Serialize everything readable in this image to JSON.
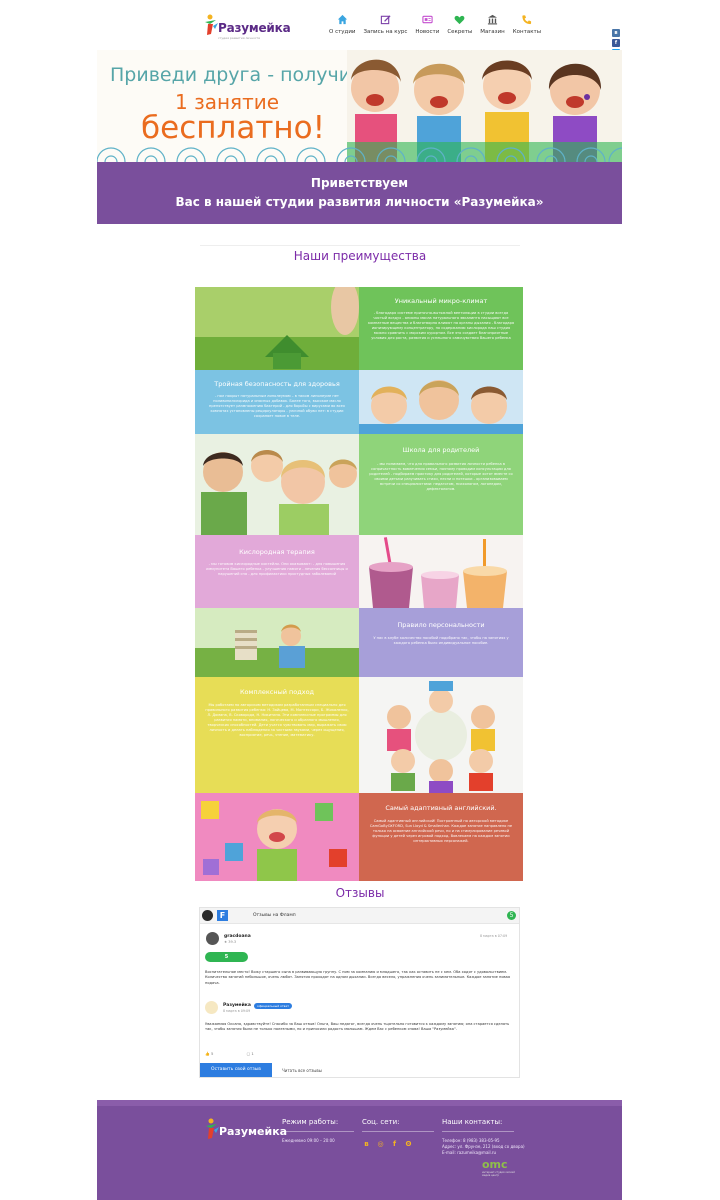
{
  "header": {
    "logo_word": "Разумейка",
    "logo_tag": "студия развития личности",
    "nav": [
      {
        "label": "О студии",
        "icon": "home-icon",
        "color": "#3aa5e0"
      },
      {
        "label": "Запись на курс",
        "icon": "edit-icon",
        "color": "#7b3fa8"
      },
      {
        "label": "Новости",
        "icon": "newspaper-icon",
        "color": "#c44fcf"
      },
      {
        "label": "Секреты",
        "icon": "heart-icon",
        "color": "#2fb552"
      },
      {
        "label": "Магазин",
        "icon": "bank-icon",
        "color": "#555555"
      },
      {
        "label": "Контакты",
        "icon": "phone-icon",
        "color": "#f4b321"
      }
    ],
    "social": [
      {
        "icon": "vk-icon",
        "glyph": "в",
        "color": "#4a76a8"
      },
      {
        "icon": "facebook-icon",
        "glyph": "f",
        "color": "#3b5998"
      },
      {
        "icon": "twitter-icon",
        "glyph": "t",
        "color": "#1da1f2"
      },
      {
        "icon": "googleplus-icon",
        "glyph": "g",
        "color": "#dd4b39"
      },
      {
        "icon": "viber-icon",
        "glyph": "v",
        "color": "#7b519d"
      },
      {
        "icon": "whatsapp-icon",
        "glyph": "w",
        "color": "#25d366"
      }
    ]
  },
  "banner": {
    "line1": "Приведи друга - получи",
    "line2": "1 занятие",
    "line3": "бесплатно!"
  },
  "welcome": {
    "line1": "Приветствуем",
    "line2": "Вас в нашей студии развития личности «Разумейка»"
  },
  "advantages_title": "Наши преимущества",
  "advantages": [
    {
      "title": "Уникальный микро-климат",
      "text": "- благодаря системе приточно-вытяжной вентиляции в студии всегда чистый воздух - анионы масла натурального эвкалипта насыщают все комнатные вещества и благотворно влияют на органы дыхания - благодаря ионизирующему концентратору, по содержанию кислорода наш студия можно сравнить с морским курортом. Все это создает благоприятные условия для роста, развития и успешного самочувствия Вашего ребенка"
    },
    {
      "title": "Тройная безопасность для здоровья",
      "text": "- пол покрыт натуральным линолеумом – в таком линолеуме нет поливинилхлорида и опасных добавок. Более того, высокое масло препятствует размножению бактерий - для борьбы с вирусами во всех комнатах установлены рециркуляторы - уличной обуви нет: в студии сохраняет новое в теле."
    },
    {
      "title": "Школа для родителей",
      "text": "- мы понимаем, что для правильного развития личности ребенка в сопричастность вовлечения семьи, поэтому проводим консультации для родителей - подбираем практику для родителей, которые хотят вместе со своими детьми разучивать стихи, песни и потешки - организовываем встречи со специалистами: педагогом, психологом, логопедом, дефектологом."
    },
    {
      "title": "Кислородная терапия",
      "text": "- мы готовим кислородные коктейли. Они оказывают: - для повышения иммунитета Вашего ребенка - улучшения памяти - лечения бессонницы и нарушений сна - для профилактики простудных заболеваний"
    },
    {
      "title": "Правило персональности",
      "text": "У нас в клубе количество пособий подобрано так, чтобы на занятиях у каждого ребенка было индивидуальное пособие."
    },
    {
      "title": "Комплексный подход",
      "text": "Мы работаем по авторским методикам разработанным специально для правильного развития ребенка: Н. Зайцева, М. Монтессори, Б. Жикаленко, Л. Домана, В. Сковорода, Н. Никитина. Эти комплексные программы для развития памяти, внимания, логического и образного мышления, творческих способностей. Дети учатся чувствовать мир, выражать свою личность и делать наблюдения за чистыми звуками, через ощущения, восприятие, речь, чтение, математику."
    },
    {
      "title": "Самый адаптивный английский.",
      "text": "Самый адаптивный английский! Построенный по авторской методике CamGoByOXFORD, Sun Lloyd & Smallenhan. Каждое занятие направлено не только на освоение английской речи, но и на стимулирование речевой функции у детей через игровой подход. Вовлекаем на каждом занятии интерактивных персонажей."
    }
  ],
  "reviews_title": "Отзывы",
  "reviews": {
    "header": "Отзывы на Фламп",
    "count": "5",
    "user": {
      "name": "gracdoana",
      "sub": "★ 39.3",
      "date": "8 марта в 07:09"
    },
    "score": "5",
    "text": "Воспитательное место! Вожу старшего сына в развивающую группу. С ним за компанию и младшего, так как оставить не с кем. Оба ходят с удовольствием. Количество занятий небольшое, очень любят. Занятия проходят на одном дыхании. Всегда весело, упражнения очень занимательные. Каждое занятие новая подача.",
    "reply": {
      "name": "Разумейка",
      "badge": "официальный ответ",
      "date": "8 марта в 09:09",
      "text": "Уважаемая Оксана, здравствуйте! Спасибо за Ваш отзыв! Ольга, Ваш педагог, всегда очень тщательно готовится к каждому занятию; она старается сделать так, чтобы занятия были не только полезными, но и приносили радость малышам. Ждем Вас с ребенком снова! Ваша \"Разумейка\"."
    },
    "likes": "5",
    "comments": "1",
    "leave_label": "Оставить свой отзыв",
    "read_all_label": "Читать все отзывы"
  },
  "footer": {
    "logo_word": "Разумейка",
    "hours_title": "Режим работы:",
    "hours_text": "Ежедневно 09:00 – 20:00",
    "social_title": "Соц. сети:",
    "contacts_title": "Наши контакты:",
    "contacts_lines": [
      "Телефон: 8 (983) 383-05-95",
      "Адрес: ул. Фрунзе, 212 (вход со двора)",
      "E-mail: razumeika@mail.ru"
    ],
    "dev": "omc",
    "dev_sub": "интернет-студия омский медиа центр"
  }
}
